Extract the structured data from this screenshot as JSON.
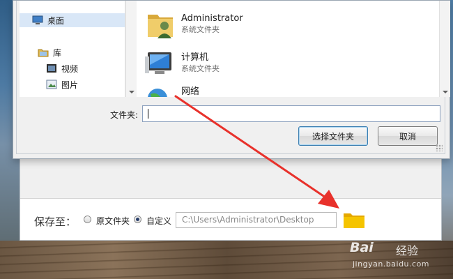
{
  "nav_pane": {
    "items": [
      {
        "label": "桌面",
        "icon": "desktop-icon",
        "selected": true
      },
      {
        "label": "库",
        "icon": "library-icon"
      },
      {
        "label": "视频",
        "icon": "video-icon"
      },
      {
        "label": "图片",
        "icon": "pictures-icon"
      }
    ]
  },
  "content_pane": {
    "items": [
      {
        "name": "Administrator",
        "type": "系统文件夹",
        "icon": "user-folder-icon"
      },
      {
        "name": "计算机",
        "type": "系统文件夹",
        "icon": "computer-icon"
      },
      {
        "name": "网络",
        "type": "",
        "icon": "network-icon"
      }
    ]
  },
  "dialog": {
    "folder_label": "文件夹:",
    "folder_value": "",
    "select_button": "选择文件夹",
    "cancel_button": "取消"
  },
  "save_row": {
    "title": "保存至：",
    "option_original": "原文件夹",
    "option_custom": "自定义",
    "selected_option": "custom",
    "path": "C:\\Users\\Administrator\\Desktop"
  },
  "colors": {
    "arrow": "#e8312b",
    "folder_yellow": "#f2b705",
    "button_focus_border": "#3c7fb1"
  },
  "watermark": {
    "brand": "Bai",
    "brand_suffix": "经验",
    "url": "jingyan.baidu.com"
  }
}
